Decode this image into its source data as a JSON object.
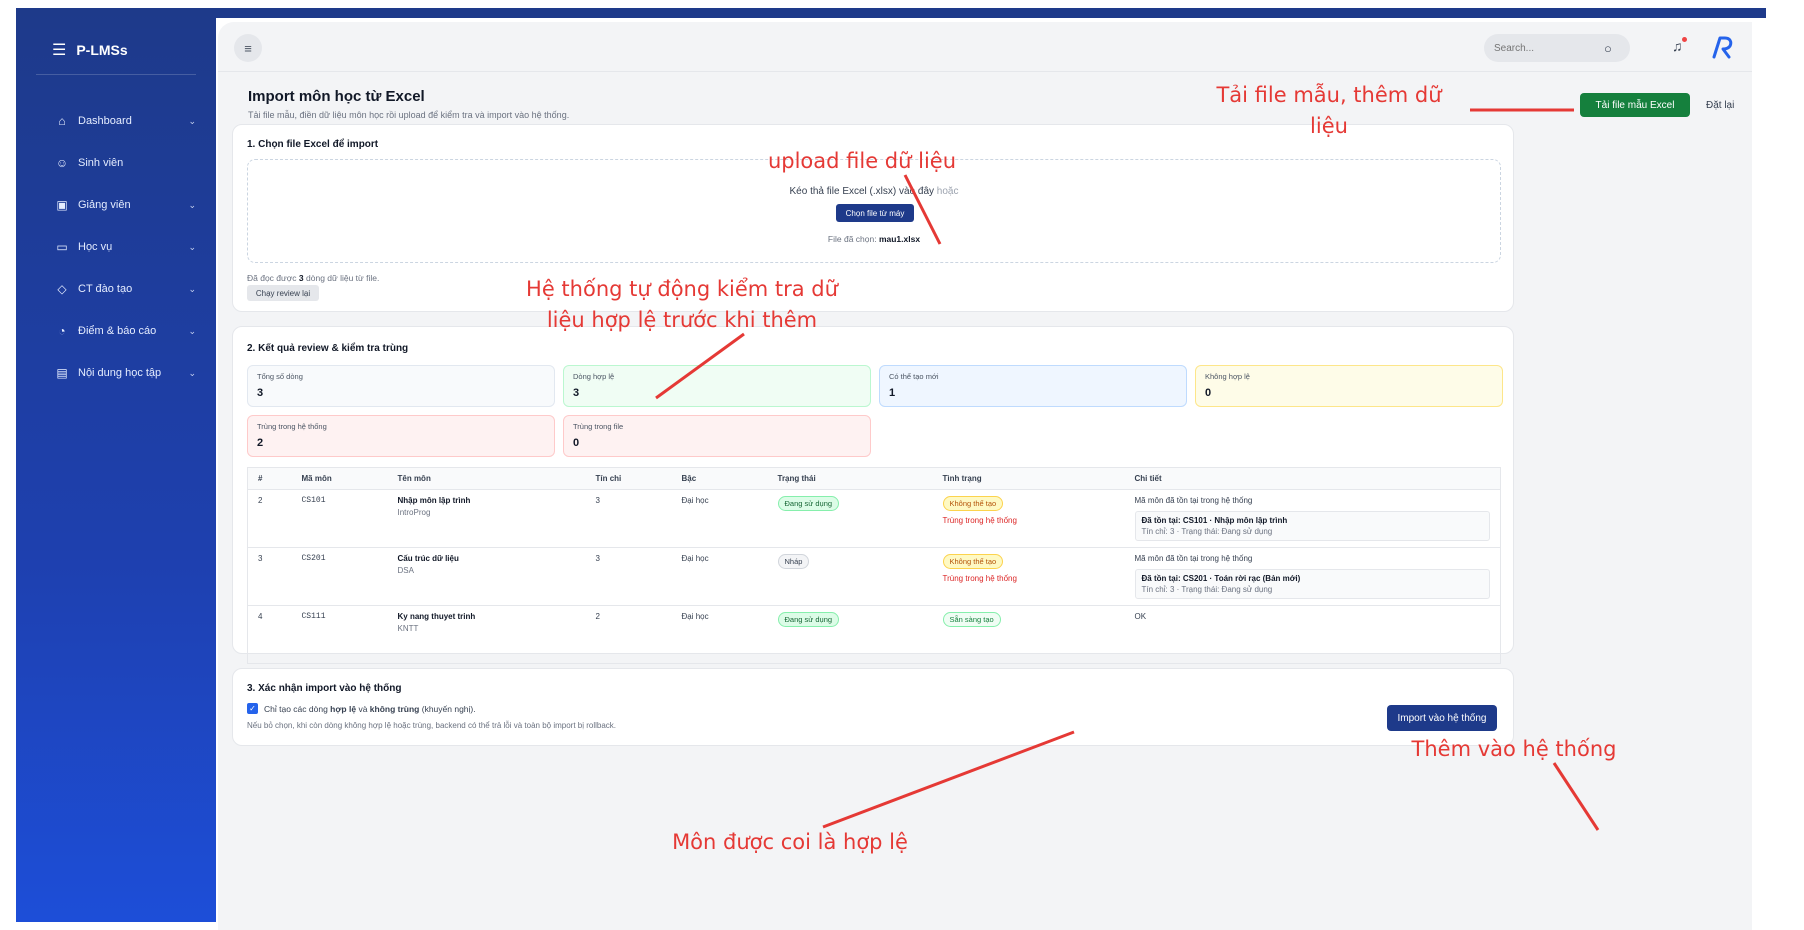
{
  "brand": {
    "name": "P-LMSs"
  },
  "sidebar": {
    "items": [
      {
        "label": "Dashboard",
        "icon": "home-icon",
        "has_submenu": true
      },
      {
        "label": "Sinh viên",
        "icon": "users-icon",
        "has_submenu": false
      },
      {
        "label": "Giảng viên",
        "icon": "contact-card-icon",
        "has_submenu": true
      },
      {
        "label": "Học vụ",
        "icon": "book-icon",
        "has_submenu": true
      },
      {
        "label": "CT đào tạo",
        "icon": "graduation-cap-icon",
        "has_submenu": true
      },
      {
        "label": "Điểm & báo cáo",
        "icon": "pie-chart-icon",
        "has_submenu": true
      },
      {
        "label": "Nội dung học tập",
        "icon": "document-icon",
        "has_submenu": true
      }
    ]
  },
  "header": {
    "search_placeholder": "Search..."
  },
  "page": {
    "title": "Import môn học từ Excel",
    "subtitle": "Tải file mẫu, điền dữ liệu môn học rồi upload để kiểm tra và import vào hệ thống.",
    "template_button": "Tải file mẫu Excel",
    "reset_button": "Đặt lại"
  },
  "section1": {
    "title": "1. Chọn file Excel để import",
    "drop_text": "Kéo thả file Excel (.xlsx) vào đây",
    "drop_or": "hoặc",
    "choose_button": "Chọn file từ máy",
    "chosen_label": "File đã chọn:",
    "chosen_file": "mau1.xlsx",
    "read_prefix": "Đã đọc được",
    "read_count": "3",
    "read_suffix": "dòng dữ liệu từ file.",
    "rerun_button": "Chạy review lại"
  },
  "section2": {
    "title": "2. Kết quả review & kiểm tra trùng",
    "stats": [
      {
        "label": "Tổng số dòng",
        "value": "3",
        "tone": "gray"
      },
      {
        "label": "Dòng hợp lệ",
        "value": "3",
        "tone": "green"
      },
      {
        "label": "Có thể tạo mới",
        "value": "1",
        "tone": "blue"
      },
      {
        "label": "Không hợp lệ",
        "value": "0",
        "tone": "yellow"
      },
      {
        "label": "Trùng trong hệ thống",
        "value": "2",
        "tone": "red"
      },
      {
        "label": "Trùng trong file",
        "value": "0",
        "tone": "red"
      }
    ],
    "columns": [
      "#",
      "Mã môn",
      "Tên môn",
      "Tín chỉ",
      "Bậc",
      "Trạng thái",
      "Tình trạng",
      "Chi tiết"
    ],
    "rows": [
      {
        "index": "2",
        "code": "CS101",
        "name": "Nhập môn lập trình",
        "short": "IntroProg",
        "credits": "3",
        "level": "Đại học",
        "status": "Đang sử dụng",
        "condition": "Không thể tạo",
        "condition_note": "Trùng trong hệ thống",
        "detail": "Mã môn đã tồn tại trong hệ thống",
        "detail_box_title": "Đã tồn tại: CS101 · Nhập môn lập trình",
        "detail_box_meta": "Tín chỉ: 3 · Trạng thái: Đang sử dụng"
      },
      {
        "index": "3",
        "code": "CS201",
        "name": "Cấu trúc dữ liệu",
        "short": "DSA",
        "credits": "3",
        "level": "Đại học",
        "status": "Nháp",
        "condition": "Không thể tạo",
        "condition_note": "Trùng trong hệ thống",
        "detail": "Mã môn đã tồn tại trong hệ thống",
        "detail_box_title": "Đã tồn tại: CS201 · Toán rời rạc (Bản mới)",
        "detail_box_meta": "Tín chỉ: 3 · Trạng thái: Đang sử dụng"
      },
      {
        "index": "4",
        "code": "CS111",
        "name": "Ky nang thuyet trinh",
        "short": "KNTT",
        "credits": "2",
        "level": "Đại học",
        "status": "Đang sử dụng",
        "condition": "Sẵn sàng tạo",
        "condition_note": "",
        "detail": "OK",
        "detail_box_title": "",
        "detail_box_meta": ""
      }
    ]
  },
  "section3": {
    "title": "3. Xác nhận import vào hệ thống",
    "option_prefix": "Chỉ tạo các dòng",
    "option_bold1": "hợp lệ",
    "option_and": "và",
    "option_bold2": "không trùng",
    "option_suffix": "(khuyến nghị).",
    "option_checked": true,
    "note": "Nếu bỏ chọn, khi còn dòng không hợp lệ hoặc trùng, backend có thể trả lỗi và toàn bộ import bị rollback.",
    "import_button": "Import vào hệ thống"
  },
  "annotations": {
    "template": [
      "Tải file mẫu, thêm dữ",
      "liệu"
    ],
    "upload": "upload file dữ liệu",
    "validate": [
      "Hệ thống tự động kiểm tra dữ",
      "liệu hợp lệ trước khi thêm"
    ],
    "add": "Thêm vào hệ thống",
    "valid": "Môn được coi là hợp lệ",
    "color": "#e53935"
  }
}
